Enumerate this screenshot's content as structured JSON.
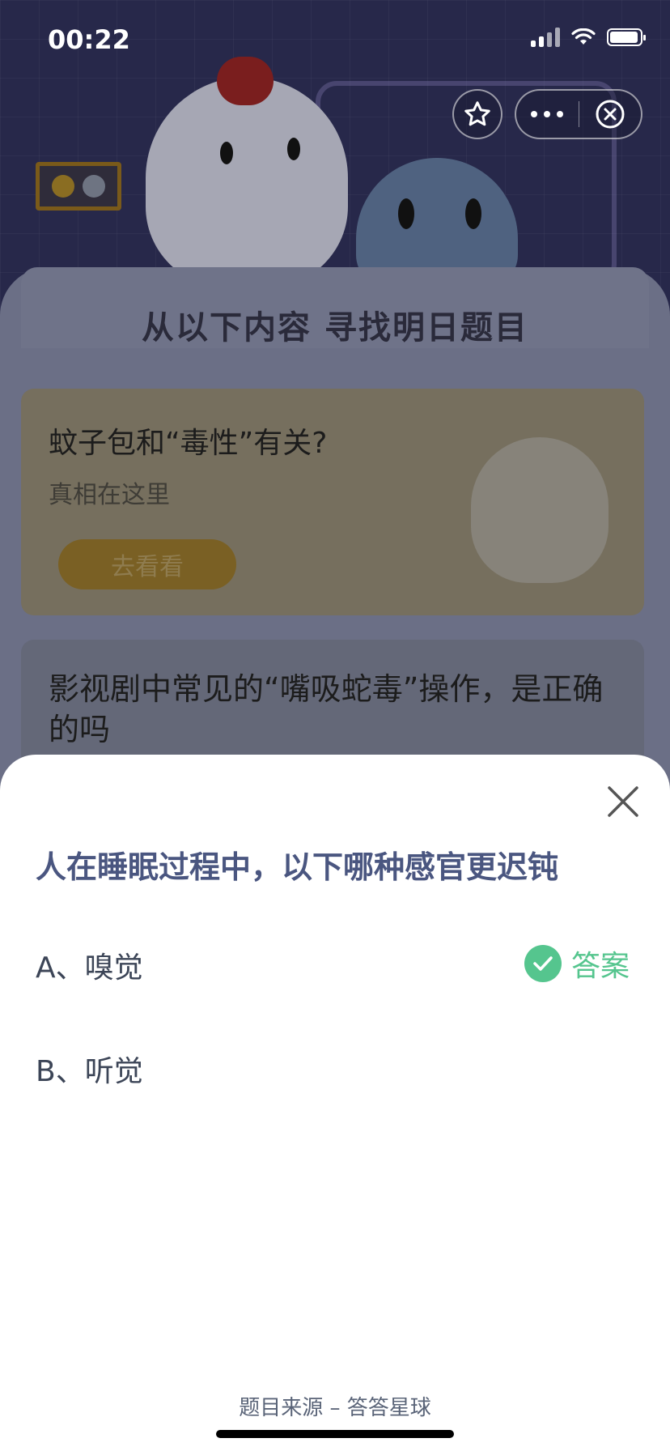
{
  "status_bar": {
    "time": "00:22"
  },
  "background": {
    "heading": "从以下内容 寻找明日题目",
    "card1": {
      "title": "蚊子包和“毒性”有关?",
      "subtitle": "真相在这里",
      "button": "去看看"
    },
    "card2": {
      "title": "影视剧中常见的“嘴吸蛇毒”操作，是正确的吗"
    }
  },
  "quiz": {
    "question": "人在睡眠过程中，以下哪种感官更迟钝",
    "options": [
      {
        "label": "A、嗅觉",
        "correct": true
      },
      {
        "label": "B、听觉",
        "correct": false
      }
    ],
    "answer_label": "答案",
    "footer": "题目来源 – 答答星球"
  },
  "colors": {
    "accent_green": "#55c58e",
    "question_blue": "#4a5680"
  },
  "icons": {
    "favorite": "star-icon",
    "more": "more-dots-icon",
    "exit": "close-circle-icon",
    "close": "close-icon",
    "correct": "check-icon"
  }
}
